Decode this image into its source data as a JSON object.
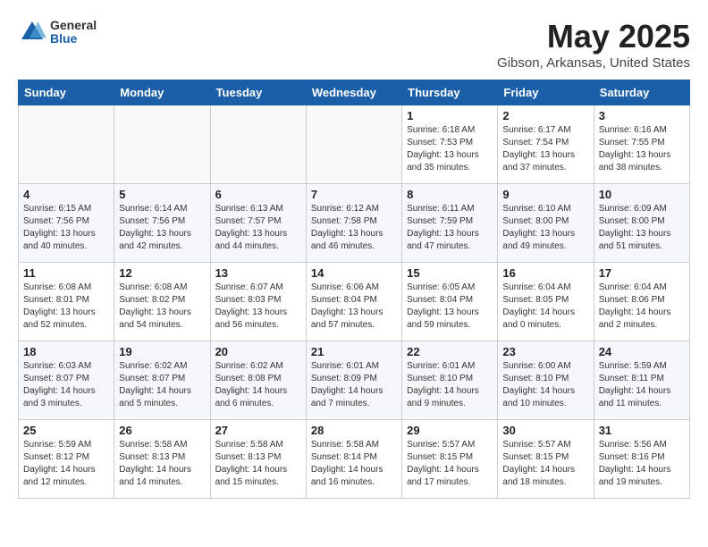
{
  "header": {
    "logo_general": "General",
    "logo_blue": "Blue",
    "month_year": "May 2025",
    "location": "Gibson, Arkansas, United States"
  },
  "days_of_week": [
    "Sunday",
    "Monday",
    "Tuesday",
    "Wednesday",
    "Thursday",
    "Friday",
    "Saturday"
  ],
  "weeks": [
    [
      {
        "day": "",
        "content": ""
      },
      {
        "day": "",
        "content": ""
      },
      {
        "day": "",
        "content": ""
      },
      {
        "day": "",
        "content": ""
      },
      {
        "day": "1",
        "content": "Sunrise: 6:18 AM\nSunset: 7:53 PM\nDaylight: 13 hours\nand 35 minutes."
      },
      {
        "day": "2",
        "content": "Sunrise: 6:17 AM\nSunset: 7:54 PM\nDaylight: 13 hours\nand 37 minutes."
      },
      {
        "day": "3",
        "content": "Sunrise: 6:16 AM\nSunset: 7:55 PM\nDaylight: 13 hours\nand 38 minutes."
      }
    ],
    [
      {
        "day": "4",
        "content": "Sunrise: 6:15 AM\nSunset: 7:56 PM\nDaylight: 13 hours\nand 40 minutes."
      },
      {
        "day": "5",
        "content": "Sunrise: 6:14 AM\nSunset: 7:56 PM\nDaylight: 13 hours\nand 42 minutes."
      },
      {
        "day": "6",
        "content": "Sunrise: 6:13 AM\nSunset: 7:57 PM\nDaylight: 13 hours\nand 44 minutes."
      },
      {
        "day": "7",
        "content": "Sunrise: 6:12 AM\nSunset: 7:58 PM\nDaylight: 13 hours\nand 46 minutes."
      },
      {
        "day": "8",
        "content": "Sunrise: 6:11 AM\nSunset: 7:59 PM\nDaylight: 13 hours\nand 47 minutes."
      },
      {
        "day": "9",
        "content": "Sunrise: 6:10 AM\nSunset: 8:00 PM\nDaylight: 13 hours\nand 49 minutes."
      },
      {
        "day": "10",
        "content": "Sunrise: 6:09 AM\nSunset: 8:00 PM\nDaylight: 13 hours\nand 51 minutes."
      }
    ],
    [
      {
        "day": "11",
        "content": "Sunrise: 6:08 AM\nSunset: 8:01 PM\nDaylight: 13 hours\nand 52 minutes."
      },
      {
        "day": "12",
        "content": "Sunrise: 6:08 AM\nSunset: 8:02 PM\nDaylight: 13 hours\nand 54 minutes."
      },
      {
        "day": "13",
        "content": "Sunrise: 6:07 AM\nSunset: 8:03 PM\nDaylight: 13 hours\nand 56 minutes."
      },
      {
        "day": "14",
        "content": "Sunrise: 6:06 AM\nSunset: 8:04 PM\nDaylight: 13 hours\nand 57 minutes."
      },
      {
        "day": "15",
        "content": "Sunrise: 6:05 AM\nSunset: 8:04 PM\nDaylight: 13 hours\nand 59 minutes."
      },
      {
        "day": "16",
        "content": "Sunrise: 6:04 AM\nSunset: 8:05 PM\nDaylight: 14 hours\nand 0 minutes."
      },
      {
        "day": "17",
        "content": "Sunrise: 6:04 AM\nSunset: 8:06 PM\nDaylight: 14 hours\nand 2 minutes."
      }
    ],
    [
      {
        "day": "18",
        "content": "Sunrise: 6:03 AM\nSunset: 8:07 PM\nDaylight: 14 hours\nand 3 minutes."
      },
      {
        "day": "19",
        "content": "Sunrise: 6:02 AM\nSunset: 8:07 PM\nDaylight: 14 hours\nand 5 minutes."
      },
      {
        "day": "20",
        "content": "Sunrise: 6:02 AM\nSunset: 8:08 PM\nDaylight: 14 hours\nand 6 minutes."
      },
      {
        "day": "21",
        "content": "Sunrise: 6:01 AM\nSunset: 8:09 PM\nDaylight: 14 hours\nand 7 minutes."
      },
      {
        "day": "22",
        "content": "Sunrise: 6:01 AM\nSunset: 8:10 PM\nDaylight: 14 hours\nand 9 minutes."
      },
      {
        "day": "23",
        "content": "Sunrise: 6:00 AM\nSunset: 8:10 PM\nDaylight: 14 hours\nand 10 minutes."
      },
      {
        "day": "24",
        "content": "Sunrise: 5:59 AM\nSunset: 8:11 PM\nDaylight: 14 hours\nand 11 minutes."
      }
    ],
    [
      {
        "day": "25",
        "content": "Sunrise: 5:59 AM\nSunset: 8:12 PM\nDaylight: 14 hours\nand 12 minutes."
      },
      {
        "day": "26",
        "content": "Sunrise: 5:58 AM\nSunset: 8:13 PM\nDaylight: 14 hours\nand 14 minutes."
      },
      {
        "day": "27",
        "content": "Sunrise: 5:58 AM\nSunset: 8:13 PM\nDaylight: 14 hours\nand 15 minutes."
      },
      {
        "day": "28",
        "content": "Sunrise: 5:58 AM\nSunset: 8:14 PM\nDaylight: 14 hours\nand 16 minutes."
      },
      {
        "day": "29",
        "content": "Sunrise: 5:57 AM\nSunset: 8:15 PM\nDaylight: 14 hours\nand 17 minutes."
      },
      {
        "day": "30",
        "content": "Sunrise: 5:57 AM\nSunset: 8:15 PM\nDaylight: 14 hours\nand 18 minutes."
      },
      {
        "day": "31",
        "content": "Sunrise: 5:56 AM\nSunset: 8:16 PM\nDaylight: 14 hours\nand 19 minutes."
      }
    ]
  ]
}
